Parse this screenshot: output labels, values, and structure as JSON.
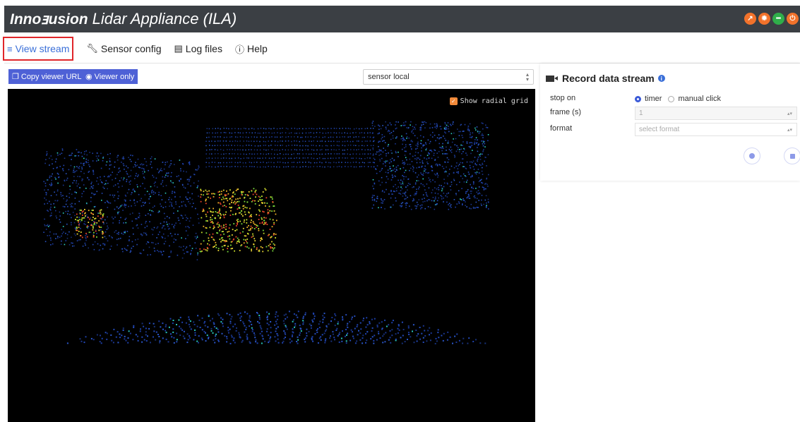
{
  "header": {
    "logo": "Innoⱻusion",
    "title": "Lidar Appliance (ILA)",
    "status_icons": [
      {
        "icon": "rocket-icon",
        "color": "#f2722b"
      },
      {
        "icon": "sun-icon",
        "color": "#f2722b"
      },
      {
        "icon": "plug-icon",
        "color": "#2fae4a"
      },
      {
        "icon": "power-icon",
        "color": "#f2722b"
      }
    ]
  },
  "nav": {
    "items": [
      {
        "label": "View stream",
        "icon": "stream-icon",
        "active": true
      },
      {
        "label": "Sensor config",
        "icon": "wrench-icon"
      },
      {
        "label": "Log files",
        "icon": "file-icon"
      },
      {
        "label": "Help",
        "icon": "info-icon"
      }
    ]
  },
  "toolbar": {
    "copy_url_label": "Copy viewer URL",
    "viewer_only_label": "Viewer only",
    "sensor_select": "sensor local"
  },
  "viewer": {
    "radial_grid_label": "Show radial grid",
    "radial_grid_checked": true
  },
  "record": {
    "title": "Record data stream",
    "stop_on_label": "stop on",
    "options": [
      "timer",
      "manual click"
    ],
    "selected_option": "timer",
    "frames_label": "frame (s)",
    "frames_value": "1",
    "format_label": "format",
    "format_placeholder": "select format"
  }
}
